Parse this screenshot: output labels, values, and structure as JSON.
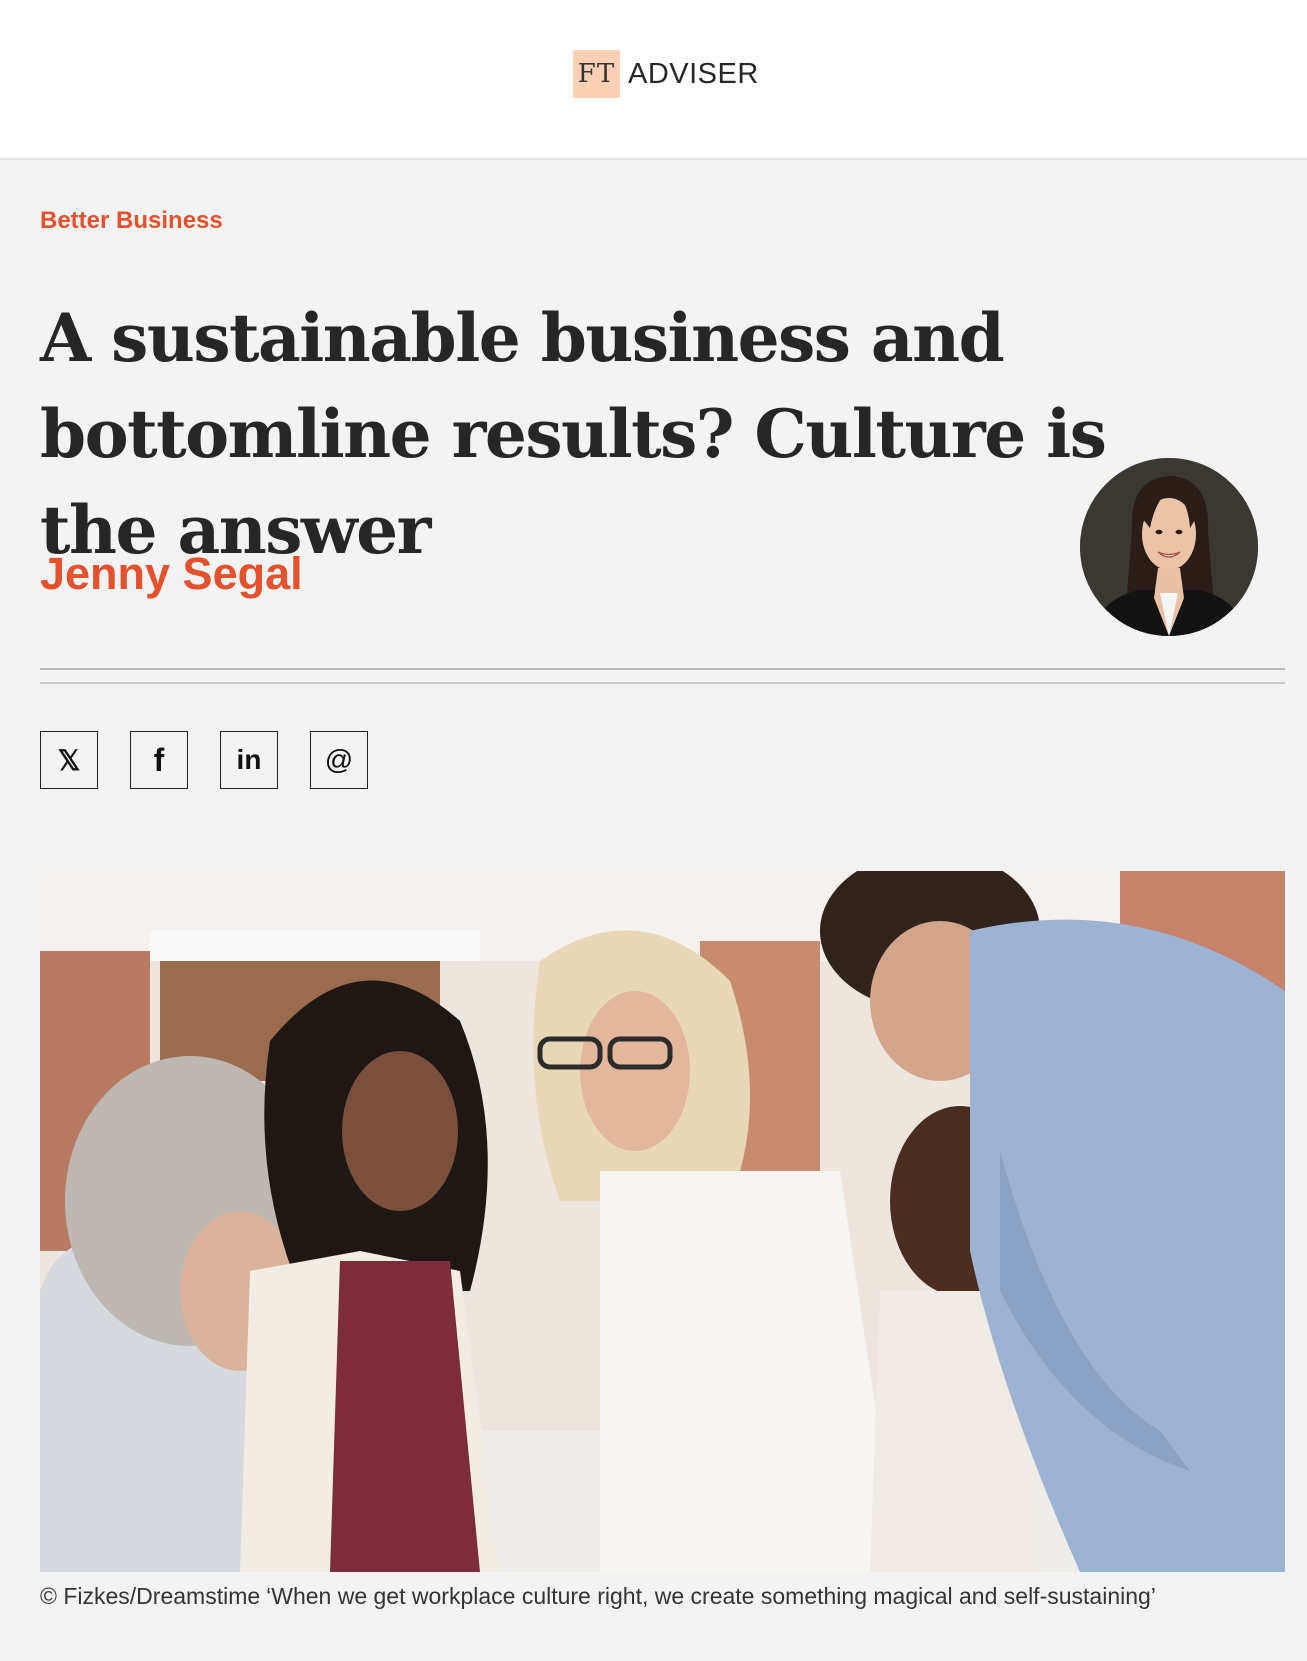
{
  "header": {
    "logo_ft": "FT",
    "logo_name": "ADVISER"
  },
  "article": {
    "section": "Better Business",
    "headline": "A sustainable business and bottomline results? Culture is the answer",
    "author": "Jenny Segal",
    "share": {
      "x": "𝕏",
      "facebook": "f",
      "linkedin": "in",
      "email": "@"
    },
    "image_caption": {
      "credit": "© Fizkes/Dreamstime",
      "quote": "‘When we get workplace culture right, we create something magical and self-sustaining’"
    }
  },
  "colors": {
    "accent": "#e5512d",
    "logo_bg": "#fcd0b4",
    "page_bg": "#f3f3f3",
    "text": "#262626"
  }
}
